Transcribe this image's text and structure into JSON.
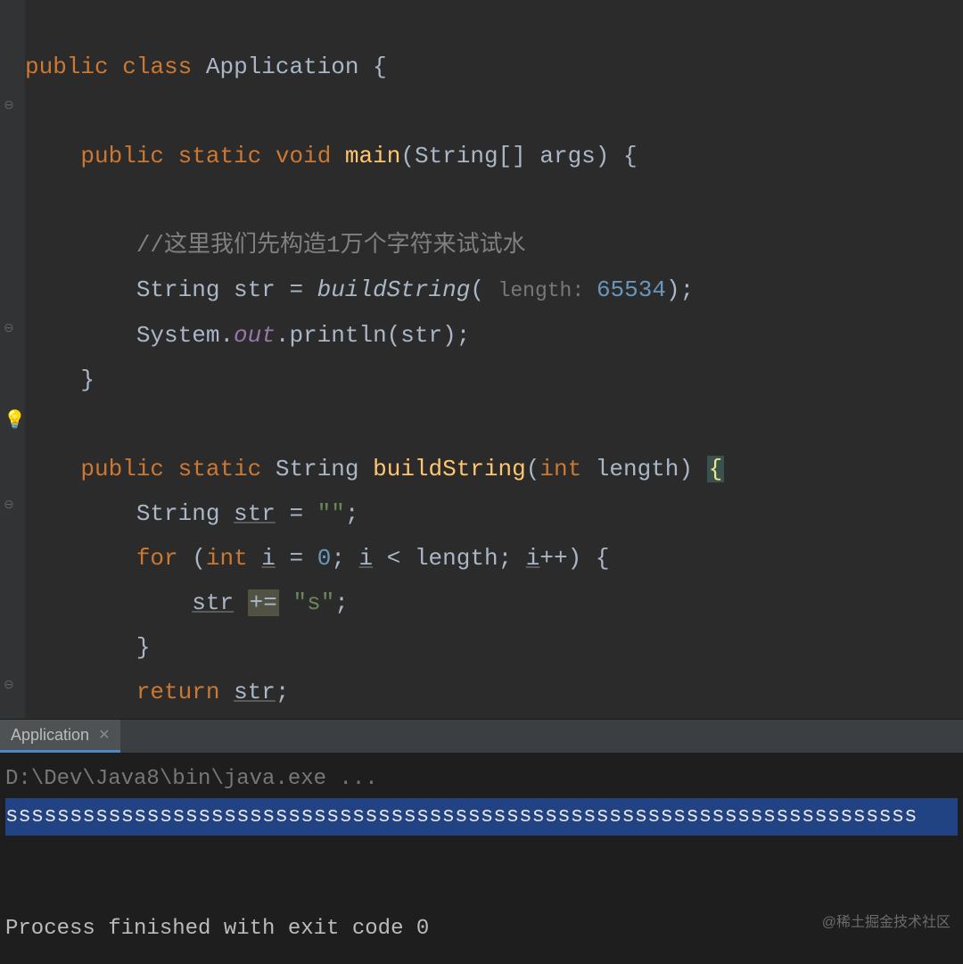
{
  "code": {
    "l1": {
      "kw1": "public",
      "kw2": "class",
      "name": "Application",
      "brace": " {"
    },
    "l3": {
      "kw1": "public",
      "kw2": "static",
      "kw3": "void",
      "m": "main",
      "params": "(String[] args) {"
    },
    "l5": {
      "cmt": "//这里我们先构造1万个字符来试试水"
    },
    "l6": {
      "pre": "String str = ",
      "call": "buildString",
      "open": "( ",
      "hint": "length: ",
      "num": "65534",
      "close": ");"
    },
    "l7": {
      "sys": "System.",
      "out": "out",
      "tail": ".println(str);"
    },
    "l8": {
      "brace": "}"
    },
    "l10": {
      "kw1": "public",
      "kw2": "static",
      "ret": " String ",
      "m": "buildString",
      "open": "(",
      "kw3": "int",
      "param": " length) ",
      "brace": "{"
    },
    "l11": {
      "pre": "String ",
      "var": "str",
      "mid": " = ",
      "str": "\"\"",
      "end": ";"
    },
    "l12": {
      "kw": "for",
      "open": " (",
      "kw2": "int",
      "sp": " ",
      "i1": "i",
      "mid1": " = ",
      "num": "0",
      "mid2": "; ",
      "i2": "i",
      "mid3": " < length; ",
      "i3": "i",
      "inc": "++",
      "close": ") {"
    },
    "l13": {
      "var": "str",
      "sp": " ",
      "op": "+=",
      "sp2": " ",
      "str": "\"s\"",
      "end": ";"
    },
    "l14": {
      "brace": "}"
    },
    "l15": {
      "kw": "return",
      "sp": " ",
      "var": "str",
      "end": ";"
    },
    "l16": {
      "brace": "}"
    }
  },
  "tab": {
    "name": "Application"
  },
  "console": {
    "cmd": "D:\\Dev\\Java8\\bin\\java.exe ...",
    "out": "sssssssssssssssssssssssssssssssssssssssssssssssssssssssssssssssssssssss",
    "exit": "Process finished with exit code 0"
  },
  "watermark": "@稀土掘金技术社区"
}
